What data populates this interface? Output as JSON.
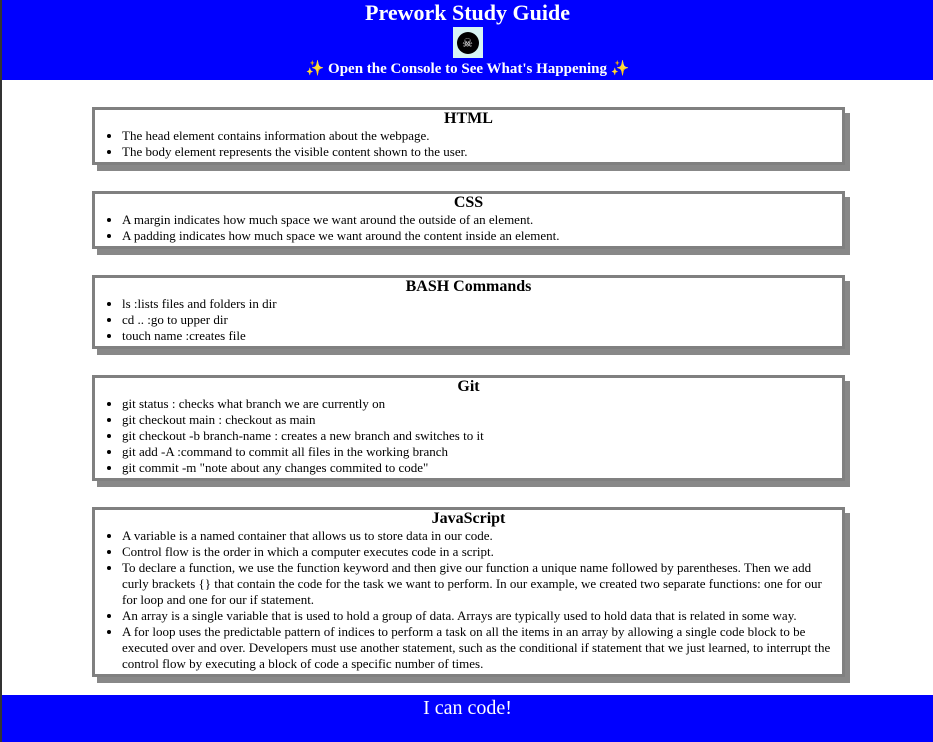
{
  "header": {
    "title": "Prework Study Guide",
    "logo_icon": "cat-skull-icon",
    "subtitle": "Open the Console to See What's Happening",
    "sparkle_icon": "✨"
  },
  "sections": [
    {
      "title": "HTML",
      "items": [
        "The head element contains information about the webpage.",
        "The body element represents the visible content shown to the user."
      ]
    },
    {
      "title": "CSS",
      "items": [
        "A margin indicates how much space we want around the outside of an element.",
        "A padding indicates how much space we want around the content inside an element."
      ]
    },
    {
      "title": "BASH Commands",
      "items": [
        "ls :lists files and folders in dir",
        "cd .. :go to upper dir",
        "touch name :creates file"
      ]
    },
    {
      "title": "Git",
      "items": [
        "git status : checks what branch we are currently on",
        "git checkout main : checkout as main",
        "git checkout -b branch-name : creates a new branch and switches to it",
        "git add -A :command to commit all files in the working branch",
        "git commit -m \"note about any changes commited to code\""
      ]
    },
    {
      "title": "JavaScript",
      "items": [
        "A variable is a named container that allows us to store data in our code.",
        "Control flow is the order in which a computer executes code in a script.",
        "To declare a function, we use the function keyword and then give our function a unique name followed by parentheses. Then we add curly brackets {} that contain the code for the task we want to perform. In our example, we created two separate functions: one for our for loop and one for our if statement.",
        "An array is a single variable that is used to hold a group of data. Arrays are typically used to hold data that is related in some way.",
        "A for loop uses the predictable pattern of indices to perform a task on all the items in an array by allowing a single code block to be executed over and over. Developers must use another statement, such as the conditional if statement that we just learned, to interrupt the control flow by executing a block of code a specific number of times."
      ]
    }
  ],
  "footer": {
    "text": "I can code!"
  },
  "colors": {
    "header_bg": "#0000ff",
    "card_border": "#808080"
  }
}
